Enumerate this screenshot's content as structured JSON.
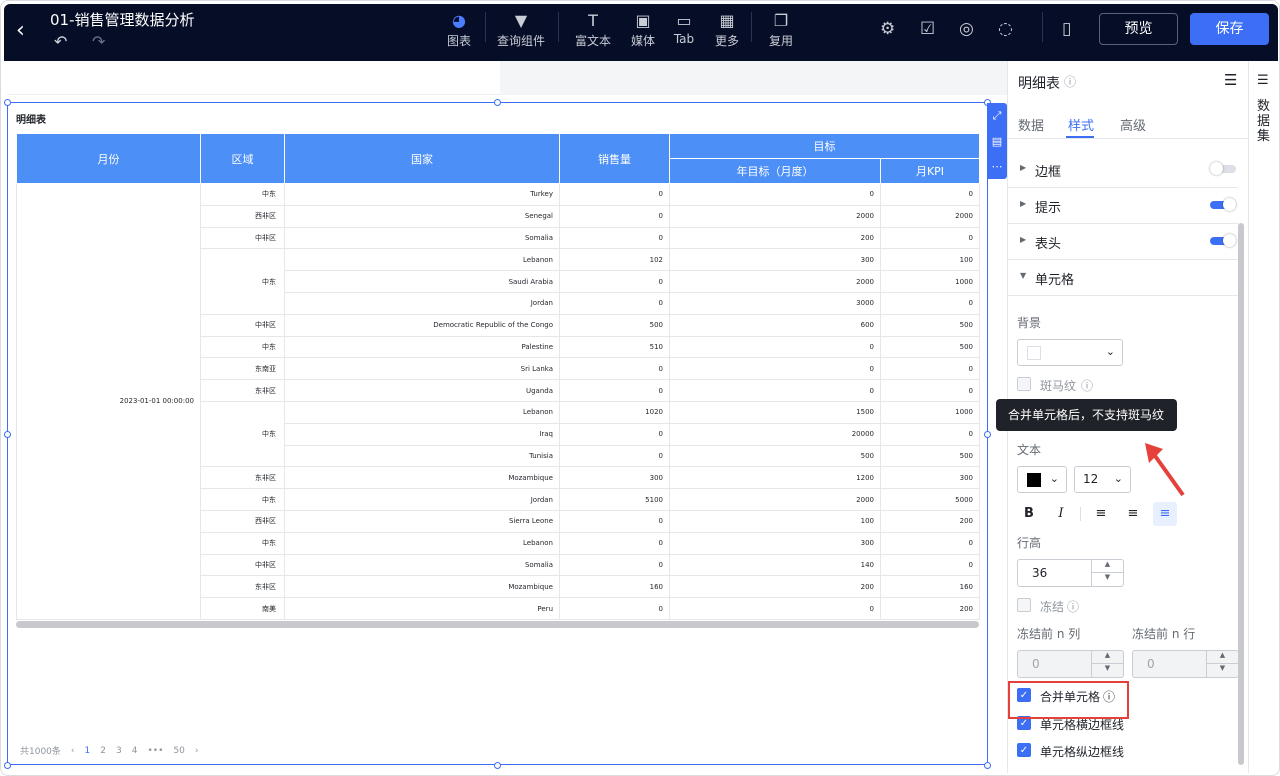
{
  "header": {
    "title": "01-销售管理数据分析",
    "tools": [
      {
        "label": "图表",
        "icon": "pie-chart-icon",
        "glyph": "◕"
      },
      {
        "label": "查询组件",
        "icon": "filter-icon",
        "glyph": "▼"
      },
      {
        "label": "富文本",
        "icon": "rich-text-icon",
        "glyph": "T"
      },
      {
        "label": "媒体",
        "icon": "image-icon",
        "glyph": "▣"
      },
      {
        "label": "Tab",
        "icon": "tab-icon",
        "glyph": "▭"
      },
      {
        "label": "更多",
        "icon": "grid-icon",
        "glyph": "▦"
      },
      {
        "label": "复用",
        "icon": "copy-icon",
        "glyph": "❐"
      }
    ],
    "preview_label": "预览",
    "save_label": "保存"
  },
  "widget": {
    "title": "明细表",
    "headers": {
      "month": "月份",
      "area": "区域",
      "country": "国家",
      "sales": "销售量",
      "target": "目标",
      "year_target": "年目标（月度）",
      "kpi": "月KPI"
    },
    "month_value": "2023-01-01 00:00:00",
    "rows": [
      {
        "area": "中东",
        "country": "Turkey",
        "sales": "0",
        "year_target": "0",
        "kpi": "0"
      },
      {
        "area": "西非区",
        "country": "Senegal",
        "sales": "0",
        "year_target": "2000",
        "kpi": "2000"
      },
      {
        "area": "中非区",
        "country": "Somalia",
        "sales": "0",
        "year_target": "200",
        "kpi": "0"
      },
      {
        "area": "中东",
        "country": "Lebanon",
        "sales": "102",
        "year_target": "300",
        "kpi": "100"
      },
      {
        "area": "",
        "country": "Saudi Arabia",
        "sales": "0",
        "year_target": "2000",
        "kpi": "1000"
      },
      {
        "area": "",
        "country": "Jordan",
        "sales": "0",
        "year_target": "3000",
        "kpi": "0"
      },
      {
        "area": "中非区",
        "country": "Democratic Republic of the Congo",
        "sales": "500",
        "year_target": "600",
        "kpi": "500"
      },
      {
        "area": "中东",
        "country": "Palestine",
        "sales": "510",
        "year_target": "0",
        "kpi": "500"
      },
      {
        "area": "东南亚",
        "country": "Sri Lanka",
        "sales": "0",
        "year_target": "0",
        "kpi": "0"
      },
      {
        "area": "东非区",
        "country": "Uganda",
        "sales": "0",
        "year_target": "0",
        "kpi": "0"
      },
      {
        "area": "中东",
        "country": "Lebanon",
        "sales": "1020",
        "year_target": "1500",
        "kpi": "1000"
      },
      {
        "area": "",
        "country": "Iraq",
        "sales": "0",
        "year_target": "20000",
        "kpi": "0"
      },
      {
        "area": "",
        "country": "Tunisia",
        "sales": "0",
        "year_target": "500",
        "kpi": "500"
      },
      {
        "area": "东非区",
        "country": "Mozambique",
        "sales": "300",
        "year_target": "1200",
        "kpi": "300"
      },
      {
        "area": "中东",
        "country": "Jordan",
        "sales": "5100",
        "year_target": "2000",
        "kpi": "5000"
      },
      {
        "area": "西非区",
        "country": "Sierra Leone",
        "sales": "0",
        "year_target": "100",
        "kpi": "200"
      },
      {
        "area": "中东",
        "country": "Lebanon",
        "sales": "0",
        "year_target": "300",
        "kpi": "0"
      },
      {
        "area": "中非区",
        "country": "Somalia",
        "sales": "0",
        "year_target": "140",
        "kpi": "0"
      },
      {
        "area": "东非区",
        "country": "Mozambique",
        "sales": "160",
        "year_target": "200",
        "kpi": "160"
      },
      {
        "area": "南美",
        "country": "Peru",
        "sales": "0",
        "year_target": "0",
        "kpi": "200"
      }
    ],
    "pager": {
      "total": "共1000条",
      "prev": "‹",
      "pages": [
        "1",
        "2",
        "3",
        "4"
      ],
      "ellipsis": "•••",
      "last": "50",
      "next": "›"
    }
  },
  "panel": {
    "title": "明细表",
    "tabs": [
      "数据",
      "样式",
      "高级"
    ],
    "sections": [
      {
        "label": "边框",
        "on": false
      },
      {
        "label": "提示",
        "on": true
      },
      {
        "label": "表头",
        "on": true
      },
      {
        "label": "单元格"
      }
    ],
    "background_label": "背景",
    "zebra_label": "斑马纹",
    "tooltip": "合并单元格后，不支持斑马纹",
    "text_label": "文本",
    "font_size": "12",
    "format_buttons": [
      "B",
      "I",
      "≡",
      "≡",
      "≡"
    ],
    "line_height_label": "行高",
    "line_height_value": "36",
    "freeze_label": "冻结",
    "freeze_cols_label": "冻结前 n 列",
    "freeze_rows_label": "冻结前 n 行",
    "freeze_cols_value": "0",
    "freeze_rows_value": "0",
    "merge_cells_label": "合并单元格",
    "h_border_label": "单元格横边框线",
    "v_border_label": "单元格纵边框线"
  },
  "dataset_strip": {
    "label": "数据集"
  },
  "colors": {
    "accent": "#3c6ff5",
    "header_bg": "#060d26",
    "table_header": "#4b8ff7",
    "highlight": "#e5413a"
  }
}
